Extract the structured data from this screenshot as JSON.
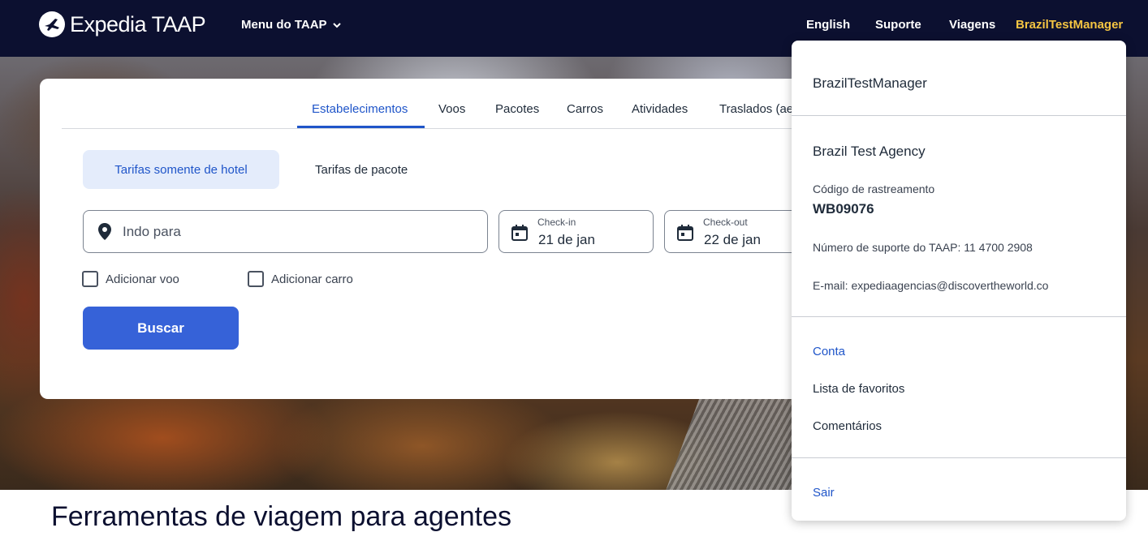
{
  "header": {
    "brand": "Expedia TAAP",
    "menu_label": "Menu do TAAP",
    "nav": {
      "language": "English",
      "support": "Suporte",
      "trips": "Viagens",
      "user": "BrazilTestManager"
    }
  },
  "search": {
    "tabs": [
      "Estabelecimentos",
      "Voos",
      "Pacotes",
      "Carros",
      "Atividades",
      "Traslados (ae"
    ],
    "active_tab": "Estabelecimentos",
    "rate_options": {
      "hotel_only": "Tarifas somente de hotel",
      "package": "Tarifas de pacote"
    },
    "destination_placeholder": "Indo para",
    "checkin": {
      "label": "Check-in",
      "value": "21 de jan"
    },
    "checkout": {
      "label": "Check-out",
      "value": "22 de jan"
    },
    "add_flight": "Adicionar voo",
    "add_car": "Adicionar carro",
    "search_button": "Buscar"
  },
  "page": {
    "section_title": "Ferramentas de viagem para agentes"
  },
  "account_menu": {
    "username": "BrazilTestManager",
    "agency": "Brazil Test Agency",
    "tracking_label": "Código de rastreamento",
    "tracking_code": "WB09076",
    "support_number": "Número de suporte do TAAP: 11 4700 2908",
    "email": "E-mail: expediaagencias@discovertheworld.co",
    "links": {
      "account": "Conta",
      "favorites": "Lista de favoritos",
      "feedback": "Comentários",
      "sign_out": "Sair"
    }
  },
  "colors": {
    "header_bg": "#0c1030",
    "accent_blue": "#1f55c9",
    "button_blue": "#3662d8",
    "user_gold": "#f5c542"
  }
}
